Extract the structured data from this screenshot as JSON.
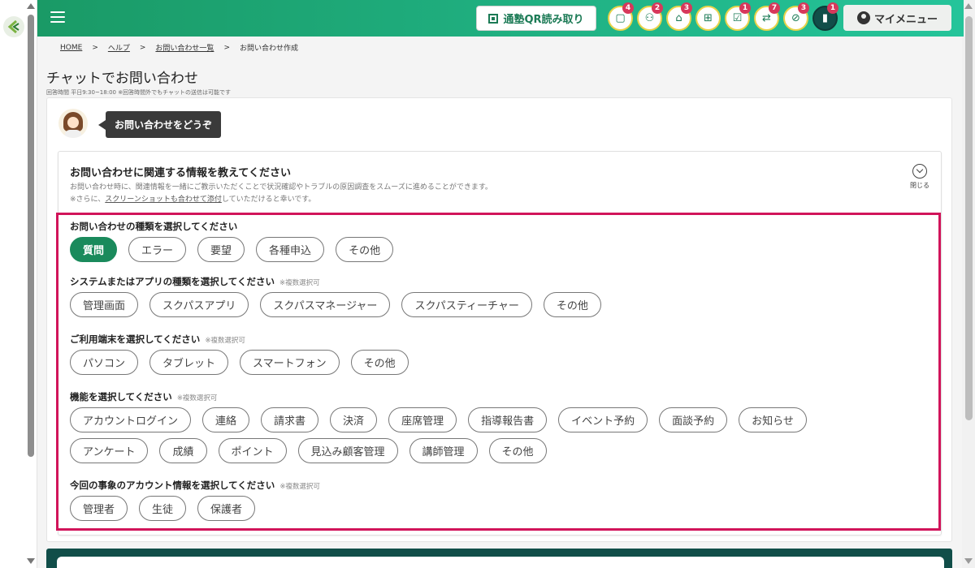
{
  "header": {
    "qr_label": "通塾QR読み取り",
    "mymenu_label": "マイメニュー",
    "icons": [
      {
        "name": "chat-icon",
        "glyph": "▢",
        "badge": "4"
      },
      {
        "name": "people-icon",
        "glyph": "⚇",
        "badge": "2"
      },
      {
        "name": "school-icon",
        "glyph": "⌂",
        "badge": "3"
      },
      {
        "name": "gift-icon",
        "glyph": "⊞",
        "badge": ""
      },
      {
        "name": "checklist-icon",
        "glyph": "☑",
        "badge": "1"
      },
      {
        "name": "transfer-icon",
        "glyph": "⇄",
        "badge": "7"
      },
      {
        "name": "no-location-icon",
        "glyph": "⊘",
        "badge": "3"
      },
      {
        "name": "message-icon",
        "glyph": "▮",
        "badge": "1"
      }
    ]
  },
  "breadcrumb": {
    "home": "HOME",
    "help": "ヘルプ",
    "list": "お問い合わせ一覧",
    "current": "お問い合わせ作成",
    "sep": ">"
  },
  "page": {
    "title": "チャットでお問い合わせ",
    "subtitle": "回答時間 平日9:30~18:00 ※回答時間外でもチャットの送信は可能です"
  },
  "chat": {
    "greeting": "お問い合わせをどうぞ"
  },
  "info": {
    "title": "お問い合わせに関連する情報を教えてください",
    "desc1": "お問い合わせ時に、関連情報を一緒にご教示いただくことで状況確認やトラブルの原因調査をスムーズに進めることができます。",
    "desc2_prefix": "※さらに、",
    "desc2_link": "スクリーンショットも合わせて添付",
    "desc2_suffix": "していただけると幸いです。",
    "close_label": "閉じる"
  },
  "questions": {
    "type": {
      "label": "お問い合わせの種類を選択してください",
      "options": [
        "質問",
        "エラー",
        "要望",
        "各種申込",
        "その他"
      ]
    },
    "system": {
      "label": "システムまたはアプリの種類を選択してください",
      "note": "※複数選択可",
      "options": [
        "管理画面",
        "スクパスアプリ",
        "スクパスマネージャー",
        "スクパスティーチャー",
        "その他"
      ]
    },
    "device": {
      "label": "ご利用端末を選択してください",
      "note": "※複数選択可",
      "options": [
        "パソコン",
        "タブレット",
        "スマートフォン",
        "その他"
      ]
    },
    "feature": {
      "label": "機能を選択してください",
      "note": "※複数選択可",
      "options": [
        "アカウントログイン",
        "連絡",
        "請求書",
        "決済",
        "座席管理",
        "指導報告書",
        "イベント予約",
        "面談予約",
        "お知らせ",
        "アンケート",
        "成績",
        "ポイント",
        "見込み顧客管理",
        "講師管理",
        "その他"
      ]
    },
    "account": {
      "label": "今回の事象のアカウント情報を選択してください",
      "note": "※複数選択可",
      "options": [
        "管理者",
        "生徒",
        "保護者"
      ]
    }
  }
}
